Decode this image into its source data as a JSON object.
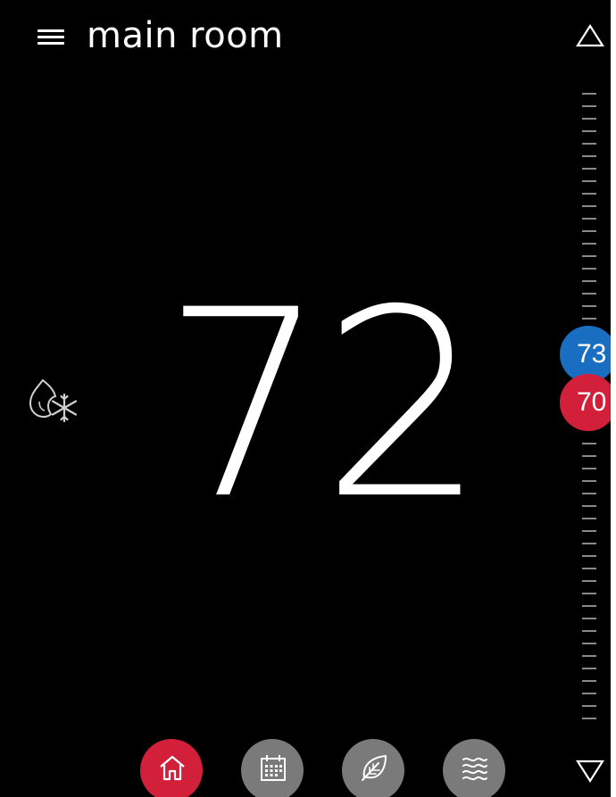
{
  "header": {
    "room_name": "main room",
    "menu_icon": "hamburger-menu-icon"
  },
  "thermostat": {
    "current_temperature": "72",
    "mode_icon": "heat-cool-mode-icon",
    "cool_setpoint": "73",
    "heat_setpoint": "70"
  },
  "scale": {
    "up_icon": "triangle-up-icon",
    "down_icon": "triangle-down-icon"
  },
  "bottom_nav": {
    "items": [
      {
        "icon": "home-icon",
        "active": true
      },
      {
        "icon": "calendar-icon",
        "active": false
      },
      {
        "icon": "leaf-icon",
        "active": false
      },
      {
        "icon": "fan-waves-icon",
        "active": false
      }
    ]
  },
  "colors": {
    "background": "#000000",
    "cool": "#1a6ec2",
    "heat": "#d2203a",
    "inactive_button": "#7a7a7a",
    "tick": "#8a8a8a",
    "text": "#ffffff"
  }
}
